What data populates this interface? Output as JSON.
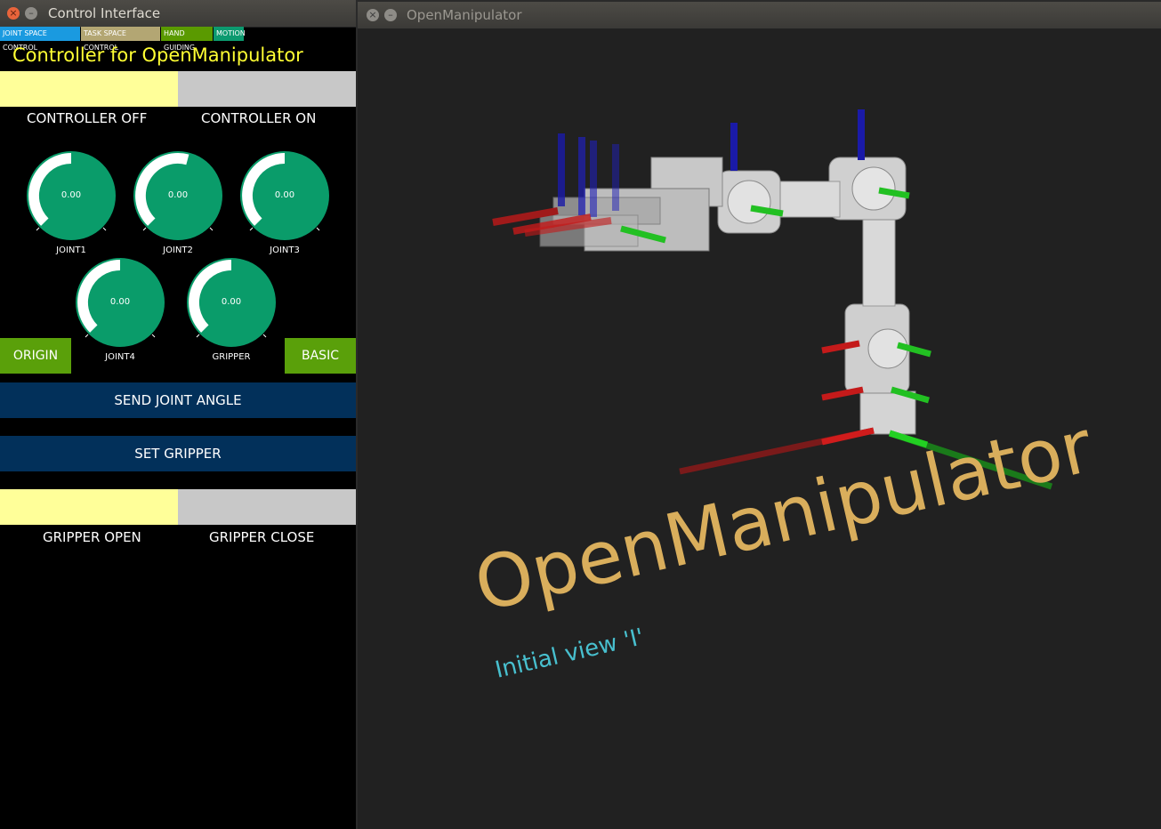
{
  "control_window": {
    "title": "Control Interface",
    "close_glyph": "×",
    "min_glyph": "–",
    "tabs": [
      {
        "label": "JOINT SPACE CONTROL",
        "color": "#1a9ae0"
      },
      {
        "label": "TASK SPACE CONTROL",
        "color": "#b3a673"
      },
      {
        "label": "HAND GUIDING",
        "color": "#5a9a00"
      },
      {
        "label": "MOTION",
        "color": "#0c9a6f"
      }
    ],
    "heading": "Controller for OpenManipulator",
    "controller_off_label": "CONTROLLER OFF",
    "controller_on_label": "CONTROLLER ON",
    "dials": [
      {
        "name": "JOINT1",
        "value": "0.00"
      },
      {
        "name": "JOINT2",
        "value": "0.00"
      },
      {
        "name": "JOINT3",
        "value": "0.00"
      },
      {
        "name": "JOINT4",
        "value": "0.00"
      },
      {
        "name": "GRIPPER",
        "value": "0.00"
      }
    ],
    "origin_label": "ORIGIN",
    "basic_label": "BASIC",
    "send_joint_angle_label": "SEND JOINT ANGLE",
    "set_gripper_label": "SET GRIPPER",
    "gripper_open_label": "GRIPPER OPEN",
    "gripper_close_label": "GRIPPER CLOSE"
  },
  "viewer_window": {
    "title": "OpenManipulator",
    "close_glyph": "×",
    "min_glyph": "–",
    "overlay_title": "OpenManipulator",
    "overlay_hint": "Initial view 'I'"
  },
  "colors": {
    "dial_green": "#0a9c6a",
    "heading_yellow": "#ffff33",
    "button_navy": "#02305a",
    "button_green": "#5aa00a",
    "overlay_title": "#d9ae5c",
    "overlay_hint": "#48c0cf"
  }
}
